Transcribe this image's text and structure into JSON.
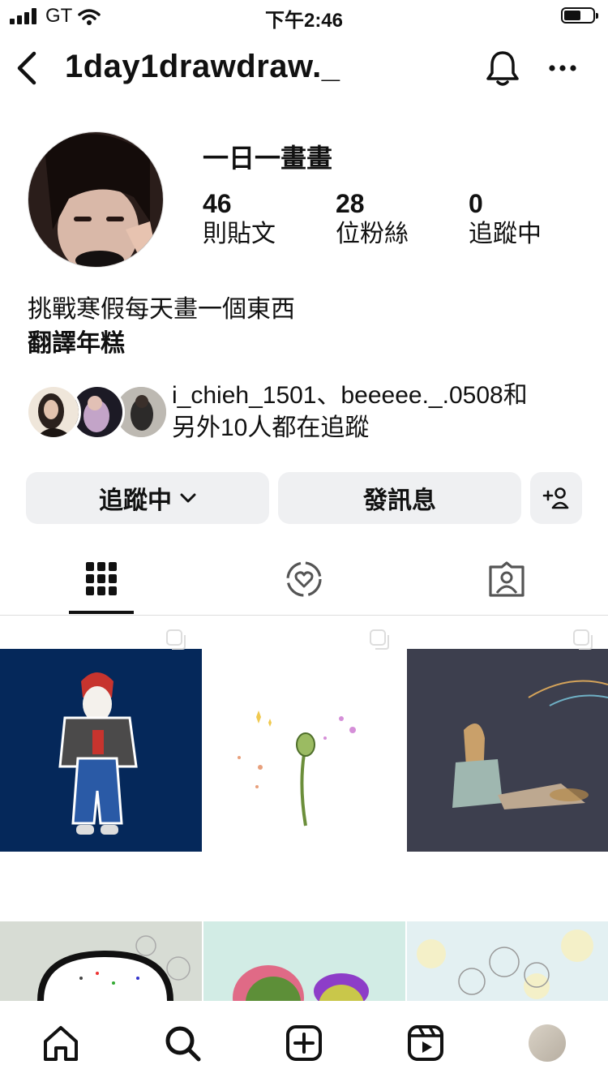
{
  "status_bar": {
    "carrier": "GT",
    "time": "下午2:46"
  },
  "header": {
    "username": "1day1drawdraw._"
  },
  "profile": {
    "display_name": "一日一畫畫",
    "stats": [
      {
        "number": "46",
        "label": "則貼文"
      },
      {
        "number": "28",
        "label": "位粉絲"
      },
      {
        "number": "0",
        "label": "追蹤中"
      }
    ],
    "bio_line1": "挑戰寒假每天畫一個東西",
    "bio_line2": "翻譯年糕",
    "followed_by_line1": "i_chieh_1501、beeeee._.0508和",
    "followed_by_line2": "另外10人都在追蹤"
  },
  "actions": {
    "following_label": "追蹤中",
    "message_label": "發訊息"
  },
  "colors": {
    "post1_bg": "#05285a",
    "post3_bg": "#3d3f4e",
    "button_bg": "#eff0f2"
  }
}
